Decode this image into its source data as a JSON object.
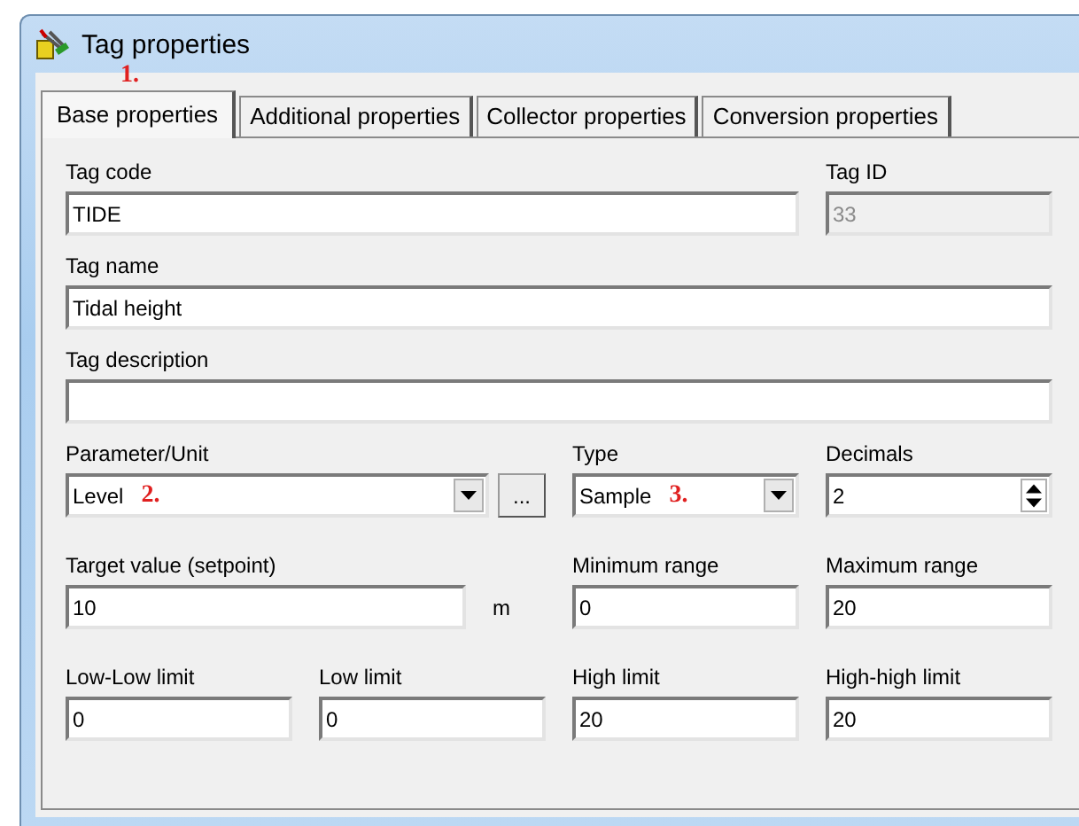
{
  "window": {
    "title": "Tag properties"
  },
  "tabs": [
    {
      "label": "Base properties",
      "selected": true,
      "annotation": "1."
    },
    {
      "label": "Additional properties",
      "selected": false
    },
    {
      "label": "Collector properties",
      "selected": false
    },
    {
      "label": "Conversion properties",
      "selected": false
    }
  ],
  "rows": [
    [
      {
        "kind": "text",
        "label": "Tag code",
        "value": "TIDE",
        "disabled": false
      },
      {
        "kind": "text",
        "label": "Tag ID",
        "value": "33",
        "disabled": true
      }
    ],
    [
      {
        "kind": "text",
        "label": "Tag name",
        "value": "Tidal height",
        "disabled": false
      }
    ],
    [
      {
        "kind": "text",
        "label": "Tag description",
        "disabled": false
      }
    ],
    [
      {
        "kind": "combo",
        "label": "Parameter/Unit",
        "value": "Level",
        "annotation": "2.",
        "button": "...",
        "disabled": false
      },
      {
        "kind": "combo",
        "label": "Type",
        "value": "Sample",
        "annotation": "3.",
        "disabled": false
      },
      {
        "kind": "spin",
        "label": "Decimals",
        "value": "2",
        "disabled": false
      }
    ],
    [
      {
        "kind": "text",
        "label": "Target value (setpoint)",
        "value": "10",
        "unit": "m",
        "disabled": false
      },
      {
        "kind": "text",
        "label": "Minimum range",
        "value": "0",
        "disabled": false
      },
      {
        "kind": "text",
        "label": "Maximum range",
        "value": "20",
        "disabled": false
      }
    ],
    [
      {
        "kind": "text",
        "label": "Low-Low limit",
        "value": "0",
        "disabled": false
      },
      {
        "kind": "text",
        "label": "Low limit",
        "value": "0",
        "disabled": false
      },
      {
        "kind": "text",
        "label": "High limit",
        "value": "20",
        "disabled": false
      },
      {
        "kind": "text",
        "label": "High-high limit",
        "value": "20",
        "disabled": false
      }
    ]
  ]
}
